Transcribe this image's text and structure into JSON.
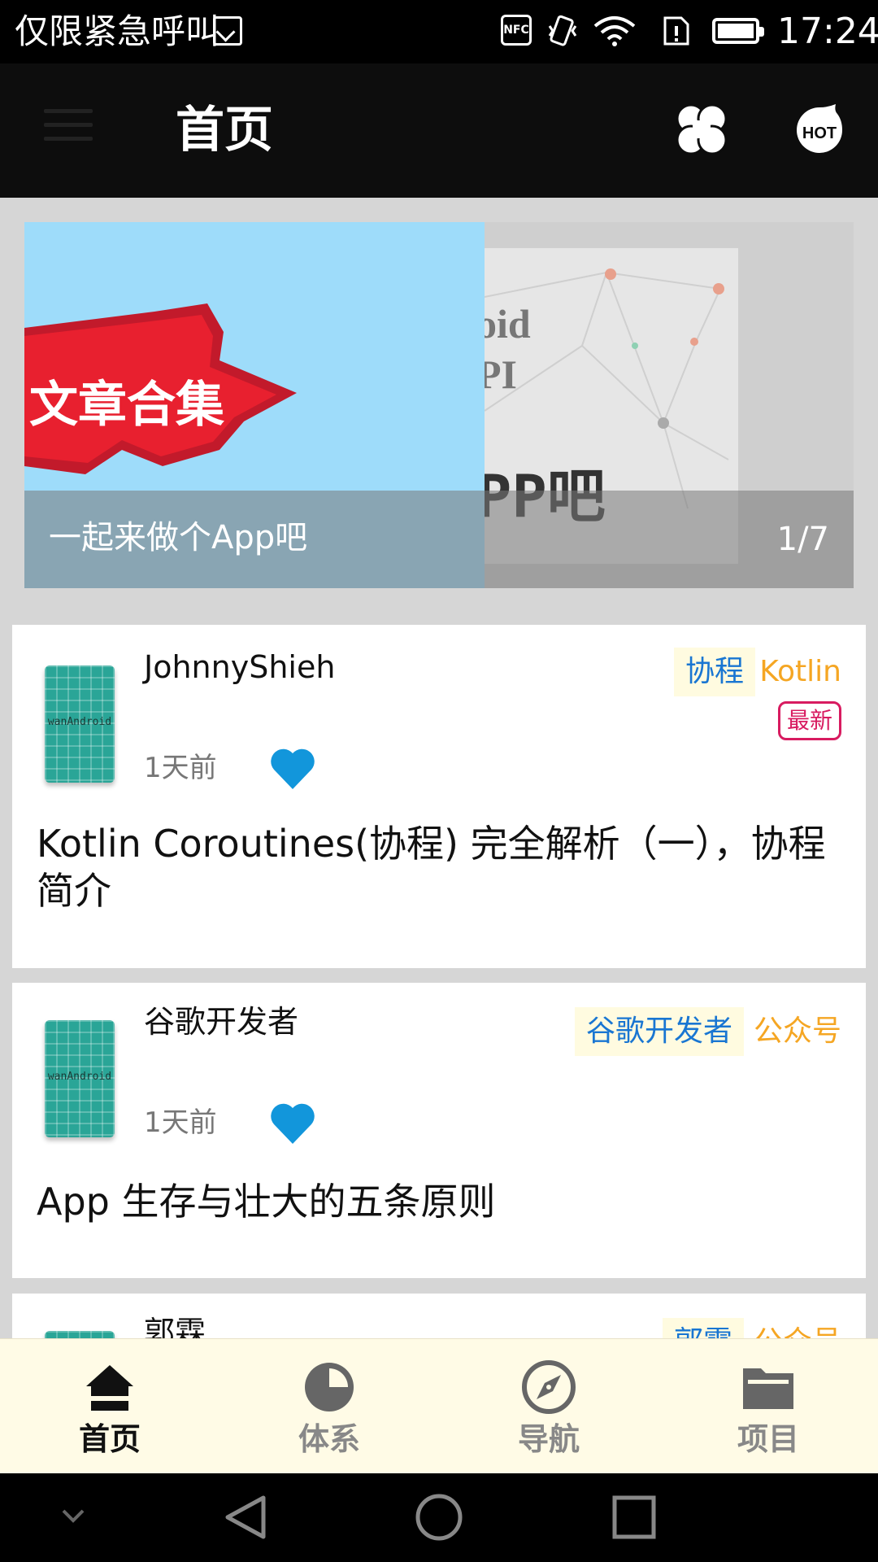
{
  "status_bar": {
    "carrier": "仅限紧急呼叫",
    "nfc": "NFC",
    "time": "17:24"
  },
  "app_bar": {
    "title": "首页"
  },
  "banner": {
    "caption": "一起来做个App吧",
    "indicator": "1/7",
    "slide1_text": "文章合集",
    "slide2_text": [
      "oid",
      "PI",
      "PP吧"
    ]
  },
  "articles": [
    {
      "author": "JohnnyShieh",
      "time": "1天前",
      "chapter": "协程",
      "super_chapter": "Kotlin",
      "badge": "最新",
      "title": "Kotlin Coroutines(协程) 完全解析（一），协程简介",
      "avatar_text": "wanAndroid"
    },
    {
      "author": "谷歌开发者",
      "time": "1天前",
      "chapter": "谷歌开发者",
      "super_chapter": "公众号",
      "title": "App 生存与壮大的五条原则",
      "avatar_text": "wanAndroid"
    },
    {
      "author": "郭霖",
      "chapter": "郭霖",
      "super_chapter": "公众号"
    }
  ],
  "bottom_nav": [
    {
      "label": "首页",
      "icon": "home-icon",
      "active": true
    },
    {
      "label": "体系",
      "icon": "pie-chart-icon",
      "active": false
    },
    {
      "label": "导航",
      "icon": "compass-icon",
      "active": false
    },
    {
      "label": "项目",
      "icon": "folder-icon",
      "active": false
    }
  ],
  "colors": {
    "accent_blue": "#1976d2",
    "heart": "#1296db",
    "orange": "#f5a623",
    "badge_red": "#d81b60"
  }
}
